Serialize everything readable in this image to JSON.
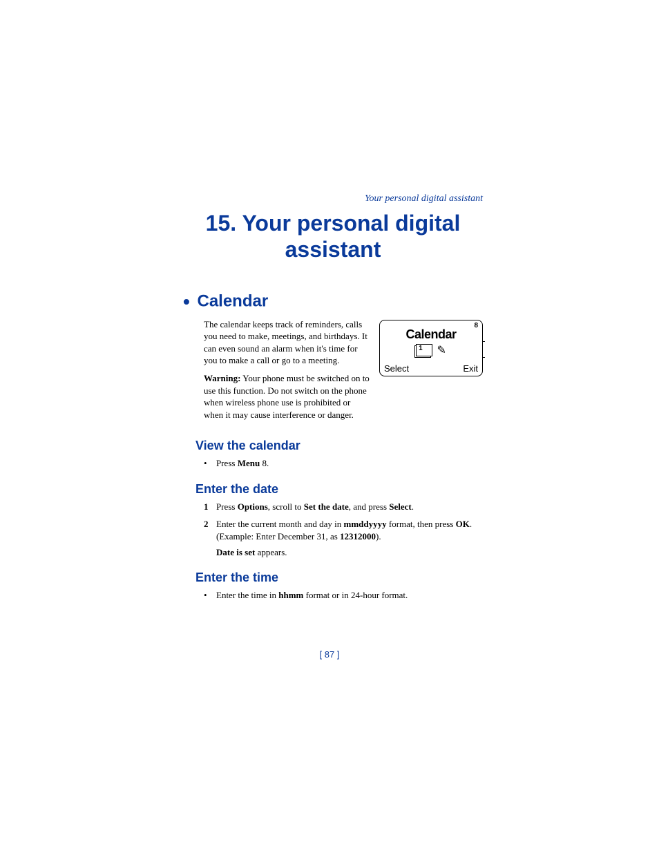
{
  "running_header": "Your personal digital assistant",
  "chapter": {
    "number": "15.",
    "title_line1": "Your personal digital",
    "title_line2": "assistant"
  },
  "section": {
    "title": "Calendar",
    "intro": "The calendar keeps track of reminders, calls you need to make, meetings, and birthdays. It can even sound an alarm when it's time for you to make a call or go to a meeting.",
    "warning_label": "Warning:",
    "warning_text": "Your phone must be switched on to use this function. Do not switch on the phone when wireless phone use is prohibited or when it may cause interference or danger."
  },
  "phone_screen": {
    "badge": "8",
    "title": "Calendar",
    "left_softkey": "Select",
    "right_softkey": "Exit"
  },
  "view_calendar": {
    "title": "View the calendar",
    "step_prefix": "Press ",
    "step_bold": "Menu",
    "step_suffix": " 8."
  },
  "enter_date": {
    "title": "Enter the date",
    "step1": {
      "num": "1",
      "p1": "Press ",
      "b1": "Options",
      "p2": ", scroll to ",
      "b2": "Set the date",
      "p3": ", and press ",
      "b3": "Select",
      "p4": "."
    },
    "step2": {
      "num": "2",
      "p1": "Enter the current month and day in ",
      "b1": "mmddyyyy",
      "p2": " format, then press ",
      "b2": "OK",
      "p3": ". (Example:  Enter December 31,  as ",
      "b3": "12312000",
      "p4": ")."
    },
    "result_bold": "Date is set",
    "result_suffix": " appears."
  },
  "enter_time": {
    "title": "Enter the time",
    "step_prefix": "Enter the time in ",
    "step_bold": "hhmm",
    "step_suffix": " format or in 24-hour format."
  },
  "page_number": "[ 87 ]"
}
